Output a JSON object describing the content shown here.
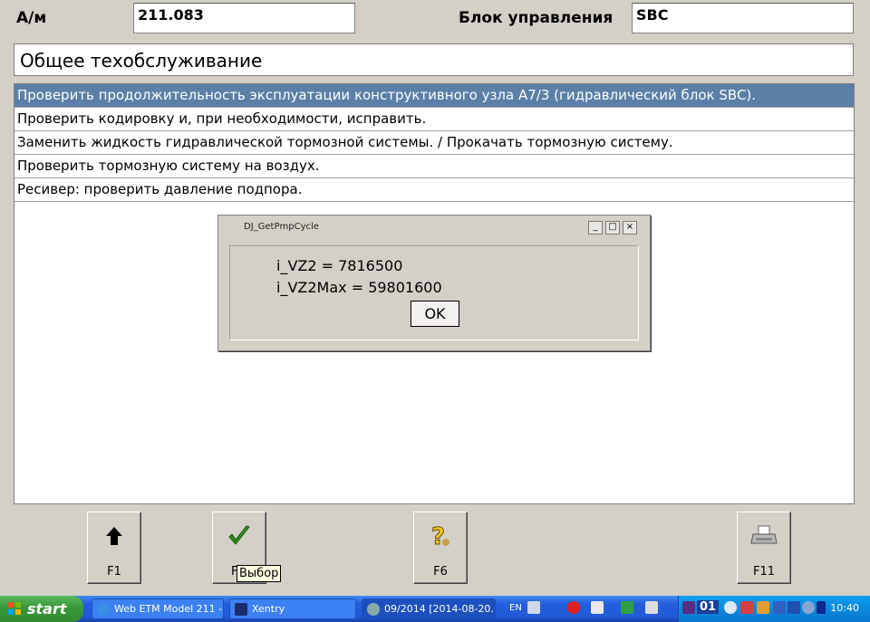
{
  "header": {
    "model_label": "А/м",
    "model_value": "211.083",
    "unit_label": "Блок управления",
    "unit_value": "SBC"
  },
  "category": "Общее техобслуживание",
  "tasks": [
    {
      "label": "Проверить продолжительность эксплуатации конструктивного узла A7/3 (гидравлический блок SBC).",
      "selected": true
    },
    {
      "label": "Проверить кодировку и, при необходимости, исправить.",
      "selected": false
    },
    {
      "label": "Заменить жидкость гидравлической тормозной системы. / Прокачать тормозную систему.",
      "selected": false
    },
    {
      "label": "Проверить тормозную систему на воздух.",
      "selected": false
    },
    {
      "label": "Ресивер: проверить давление подпора.",
      "selected": false
    }
  ],
  "dialog": {
    "title": "DJ_GetPmpCycle",
    "line1": "i_VZ2 = 7816500",
    "line2": "i_VZ2Max = 59801600",
    "ok_label": "OK",
    "min_glyph": "_",
    "max_glyph": "□",
    "close_glyph": "×"
  },
  "function_keys": [
    {
      "label": "F1",
      "icon": "arrow-up-icon"
    },
    {
      "label": "F",
      "icon": "checkmark-icon"
    },
    {
      "label": "F6",
      "icon": "help-icon"
    },
    {
      "label": "F11",
      "icon": "printer-icon"
    }
  ],
  "tooltip": "Выбор",
  "taskbar": {
    "start_label": "start",
    "buttons": [
      {
        "label": "Web ETM Model 211 -...",
        "icon": "browser-icon"
      },
      {
        "label": "Xentry",
        "icon": "xentry-icon"
      },
      {
        "label": "09/2014 [2014-08-20...",
        "icon": "app-icon"
      }
    ],
    "language": "EN",
    "tray_badge": "01",
    "clock": "10:40"
  },
  "colors": {
    "selection": "#5b7fa7",
    "window_bg": "#d4d0c8",
    "taskbar": "#245edc",
    "start_green": "#3c9a3c"
  }
}
